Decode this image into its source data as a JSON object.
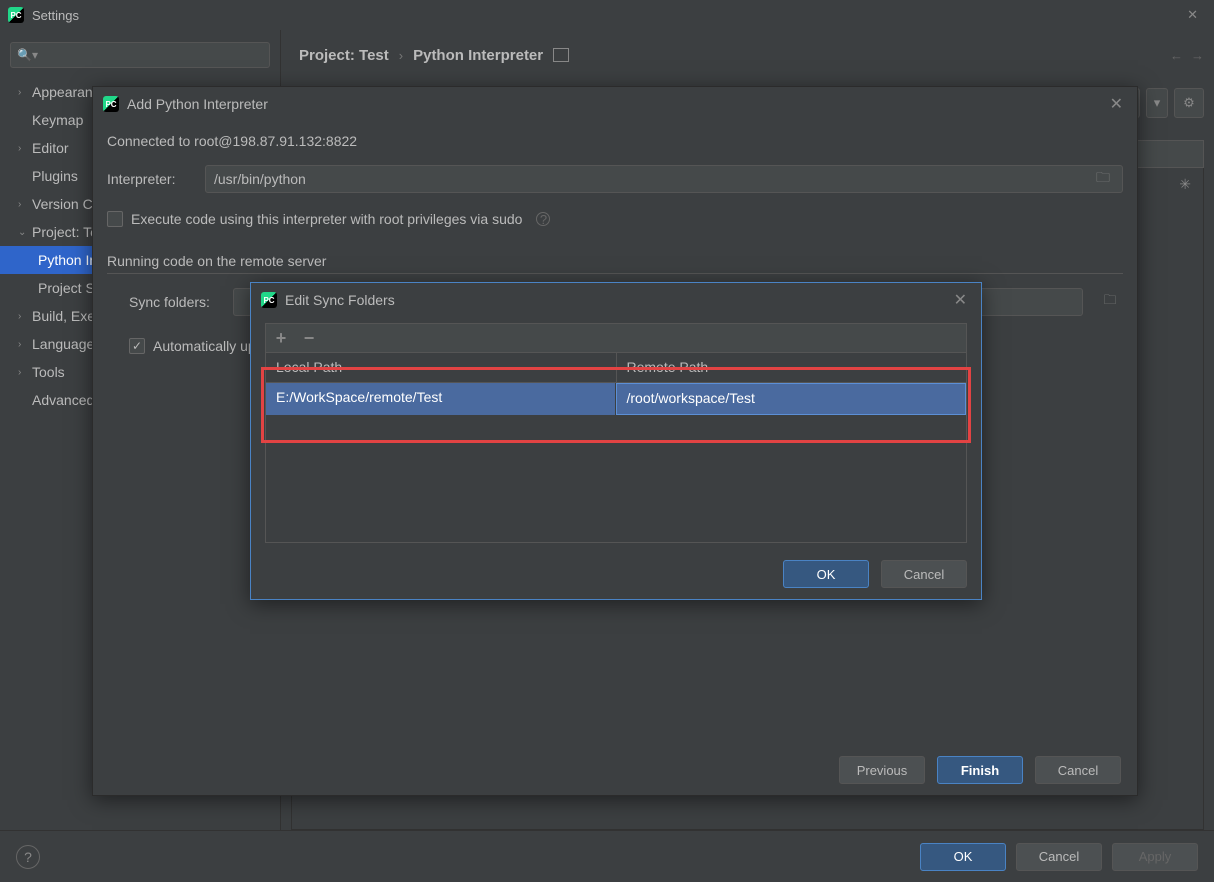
{
  "window": {
    "title": "Settings"
  },
  "sidebar": {
    "items": [
      {
        "label": "Appearance & Behavior",
        "expandable": true
      },
      {
        "label": "Keymap"
      },
      {
        "label": "Editor",
        "expandable": true
      },
      {
        "label": "Plugins"
      },
      {
        "label": "Version Control",
        "expandable": true
      },
      {
        "label": "Project: Test",
        "expandable": true,
        "expanded": true,
        "children": [
          {
            "label": "Python Interpreter",
            "selected": true
          },
          {
            "label": "Project Structure"
          }
        ]
      },
      {
        "label": "Build, Execution, Deployment",
        "expandable": true
      },
      {
        "label": "Languages & Frameworks",
        "expandable": true
      },
      {
        "label": "Tools",
        "expandable": true
      },
      {
        "label": "Advanced Settings"
      }
    ]
  },
  "breadcrumb": {
    "project": "Project: Test",
    "page": "Python Interpreter"
  },
  "footer": {
    "ok": "OK",
    "cancel": "Cancel",
    "apply": "Apply"
  },
  "dialog1": {
    "title": "Add Python Interpreter",
    "connected": "Connected to root@198.87.91.132:8822",
    "interpreter_label": "Interpreter:",
    "interpreter_value": "/usr/bin/python",
    "sudo_label": "Execute code using this interpreter with root privileges via sudo",
    "section": "Running code on the remote server",
    "sync_label": "Sync folders:",
    "auto_label": "Automatically upload project files to the server",
    "previous": "Previous",
    "finish": "Finish",
    "cancel": "Cancel"
  },
  "dialog2": {
    "title": "Edit Sync Folders",
    "col_local": "Local Path",
    "col_remote": "Remote Path",
    "row": {
      "local": "E:/WorkSpace/remote/Test",
      "remote": "/root/workspace/Test"
    },
    "ok": "OK",
    "cancel": "Cancel"
  }
}
